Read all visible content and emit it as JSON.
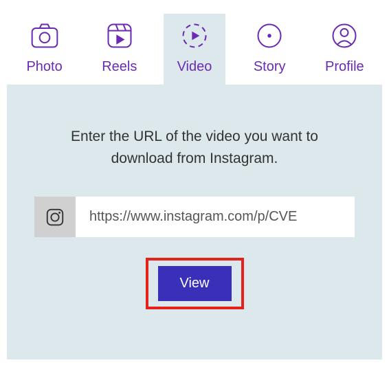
{
  "tabs": [
    {
      "id": "photo",
      "label": "Photo"
    },
    {
      "id": "reels",
      "label": "Reels"
    },
    {
      "id": "video",
      "label": "Video"
    },
    {
      "id": "story",
      "label": "Story"
    },
    {
      "id": "profile",
      "label": "Profile"
    }
  ],
  "active_tab": "video",
  "instruction": "Enter the URL of the video you want to download from Instagram.",
  "url_input": {
    "value": "https://www.instagram.com/p/CVE"
  },
  "view_button_label": "View",
  "colors": {
    "accent": "#6a2ab3",
    "panel": "#dce8ec",
    "button": "#3a2fb8",
    "highlight": "#e3231a"
  }
}
